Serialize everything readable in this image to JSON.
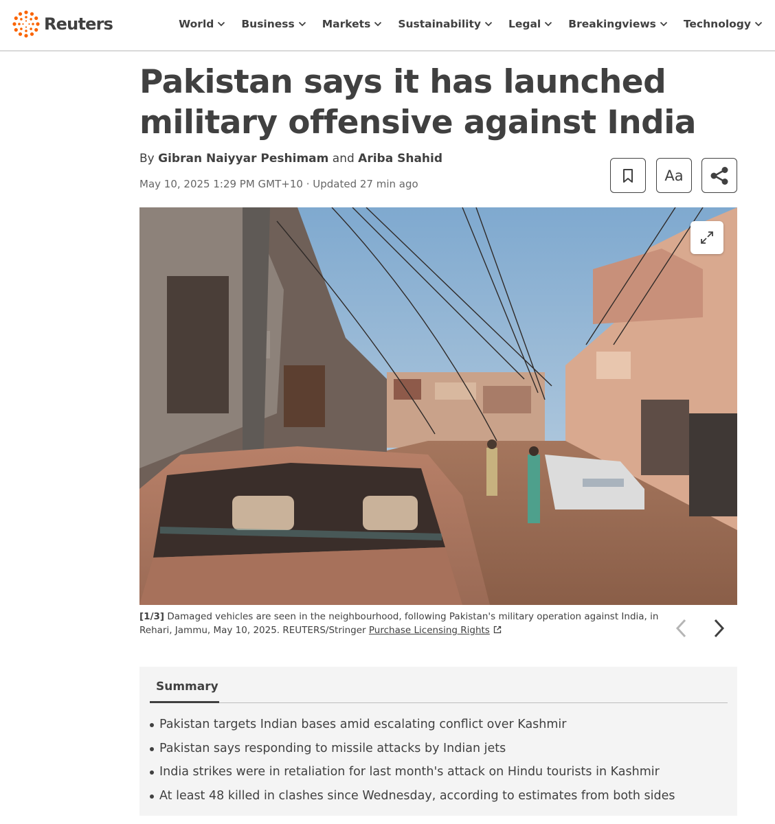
{
  "header": {
    "brand": "Reuters",
    "brand_color": "#fa6400",
    "nav": [
      "World",
      "Business",
      "Markets",
      "Sustainability",
      "Legal",
      "Breakingviews",
      "Technology"
    ]
  },
  "article": {
    "headline": "Pakistan says it has launched military offensive against India",
    "byline": {
      "prefix": "By",
      "author1": "Gibran Naiyyar Peshimam",
      "conjunction": "and",
      "author2": "Ariba Shahid"
    },
    "dateline": "May 10, 2025 1:29 PM GMT+10 · Updated 27 min ago",
    "tools": {
      "bookmark_icon": "bookmark-icon",
      "text_size_label": "Aa",
      "share_icon": "share-icon"
    }
  },
  "photo": {
    "counter": "[1/3]",
    "caption": "Damaged vehicles are seen in the neighbourhood, following Pakistan's military operation against India, in Rehari, Jammu, May 10, 2025. REUTERS/Stringer",
    "licensing_link": "Purchase Licensing Rights"
  },
  "summary": {
    "tab_label": "Summary",
    "bullets": [
      "Pakistan targets Indian bases amid escalating conflict over Kashmir",
      "Pakistan says responding to missile attacks by Indian jets",
      "India strikes were in retaliation for last month's attack on Hindu tourists in Kashmir",
      "At least 48 killed in clashes since Wednesday, according to estimates from both sides"
    ]
  }
}
